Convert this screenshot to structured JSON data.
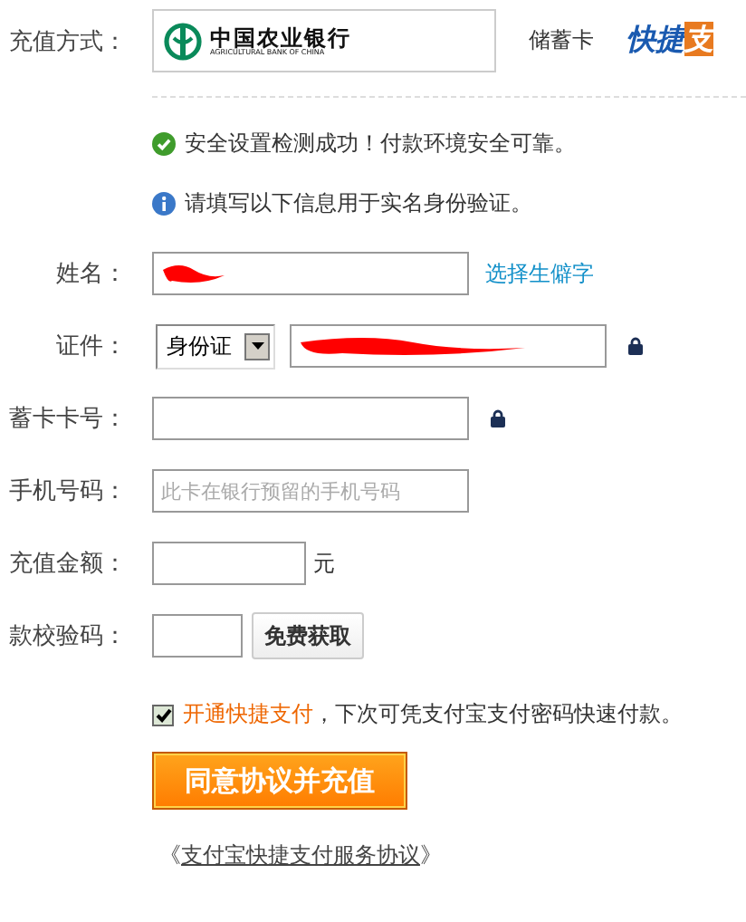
{
  "payment_method": {
    "label": "充值方式：",
    "bank_name": "中国农业银行",
    "bank_name_en": "AGRICULTURAL BANK OF CHINA",
    "card_type": "储蓄卡",
    "quick_pay_logo": {
      "blue_part": "快捷",
      "orange_part": "支"
    }
  },
  "notices": [
    {
      "kind": "success",
      "text": "安全设置检测成功！付款环境安全可靠。"
    },
    {
      "kind": "info",
      "text": "请填写以下信息用于实名身份验证。"
    }
  ],
  "form": {
    "name": {
      "label": "姓名：",
      "redacted": true,
      "link": "选择生僻字"
    },
    "id": {
      "label": "证件：",
      "id_type": "身份证",
      "redacted": true,
      "locked": true
    },
    "card_number": {
      "label": "蓄卡卡号：",
      "locked": true
    },
    "phone": {
      "label": "手机号码：",
      "placeholder": "此卡在银行预留的手机号码"
    },
    "amount": {
      "label": "充值金额：",
      "unit": "元"
    },
    "code": {
      "label": "款校验码：",
      "button": "免费获取"
    }
  },
  "quick_pay_option": {
    "checked": true,
    "link": "开通快捷支付",
    "text": "，下次可凭支付宝支付密码快速付款。"
  },
  "submit": "同意协议并充值",
  "agreement": {
    "open": "《",
    "link": "支付宝快捷支付服务协议",
    "close": "》"
  }
}
